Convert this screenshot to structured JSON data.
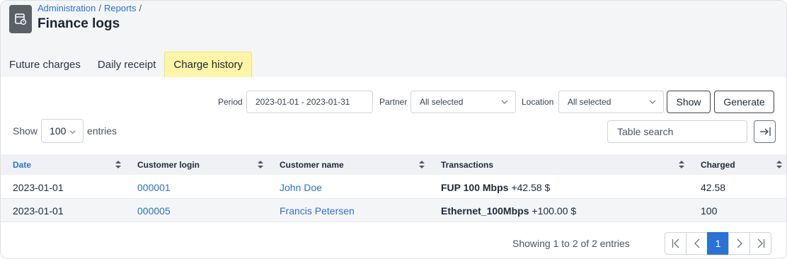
{
  "header": {
    "breadcrumb": [
      "Administration",
      "Reports"
    ],
    "separator": "/",
    "title": "Finance logs"
  },
  "tabs": [
    {
      "label": "Future charges",
      "active": false
    },
    {
      "label": "Daily receipt",
      "active": false
    },
    {
      "label": "Charge history",
      "active": true
    }
  ],
  "filters": {
    "period_label": "Period",
    "period_value": "2023-01-01 - 2023-01-31",
    "partner_label": "Partner",
    "partner_value": "All selected",
    "location_label": "Location",
    "location_value": "All selected",
    "show_button": "Show",
    "generate_button": "Generate"
  },
  "table_controls": {
    "show_label": "Show",
    "entries_value": "100",
    "entries_label": "entries",
    "search_placeholder": "Table search"
  },
  "table": {
    "columns": [
      "Date",
      "Customer login",
      "Customer name",
      "Transactions",
      "Charged"
    ],
    "rows": [
      {
        "date": "2023-01-01",
        "login": "000001",
        "name": "John Doe",
        "tx_name": "FUP 100 Mbps",
        "tx_amount": "+42.58 $",
        "charged": "42.58"
      },
      {
        "date": "2023-01-01",
        "login": "000005",
        "name": "Francis Petersen",
        "tx_name": "Ethernet_100Mbps",
        "tx_amount": "+100.00 $",
        "charged": "100"
      }
    ]
  },
  "footer": {
    "info": "Showing 1 to 2 of 2 entries",
    "current_page": "1"
  },
  "colors": {
    "accent": "#2a72d6",
    "active_tab": "#fdf5a8",
    "header_bg": "#f4f5f7"
  },
  "icons": [
    "report-icon",
    "chevron-down-icon",
    "sort-icon",
    "export-icon",
    "first-page-icon",
    "prev-page-icon",
    "next-page-icon",
    "last-page-icon"
  ]
}
